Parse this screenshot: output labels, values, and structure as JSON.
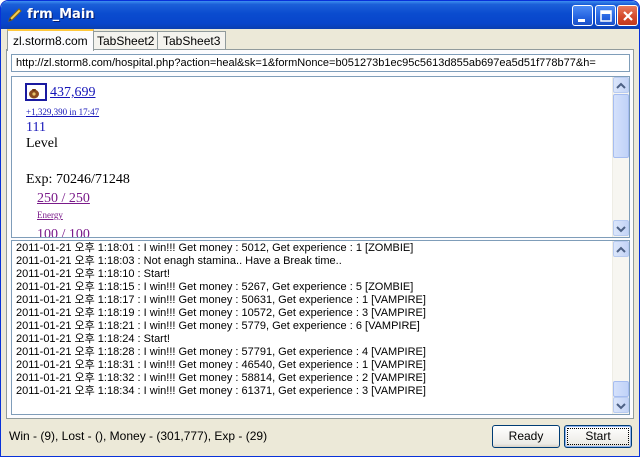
{
  "window": {
    "title": "frm_Main"
  },
  "tabs": [
    {
      "label": "zl.storm8.com"
    },
    {
      "label": "TabSheet2"
    },
    {
      "label": "TabSheet3"
    }
  ],
  "url": {
    "value": "http://zl.storm8.com/hospital.php?action=heal&sk=1&formNonce=b051273b1ec95c5613d855ab697ea5d51f778b77&h="
  },
  "web": {
    "cash": "437,699",
    "cash_sub": "+1,329,390 in 17:47",
    "level_value": "111",
    "level_label": "Level",
    "exp": "Exp: 70246/71248",
    "energy_value": "250 / 250",
    "energy_label": "Energy",
    "health_value": "100 / 100"
  },
  "log": {
    "lines": [
      "2011-01-21 오후 1:18:01 : I win!!! Get money : 5012, Get experience : 1 [ZOMBIE]",
      "2011-01-21 오후 1:18:03 : Not enagh stamina.. Have a Break time..",
      "2011-01-21 오후 1:18:10 : Start!",
      "2011-01-21 오후 1:18:15 : I win!!! Get money : 5267, Get experience : 5 [ZOMBIE]",
      "2011-01-21 오후 1:18:17 : I win!!! Get money : 50631, Get experience : 1 [VAMPIRE]",
      "2011-01-21 오후 1:18:19 : I win!!! Get money : 10572, Get experience : 3 [VAMPIRE]",
      "2011-01-21 오후 1:18:21 : I win!!! Get money : 5779, Get experience : 6 [VAMPIRE]",
      "2011-01-21 오후 1:18:24 : Start!",
      "2011-01-21 오후 1:18:28 : I win!!! Get money : 57791, Get experience : 4 [VAMPIRE]",
      "2011-01-21 오후 1:18:31 : I win!!! Get money : 46540, Get experience : 1 [VAMPIRE]",
      "2011-01-21 오후 1:18:32 : I win!!! Get money : 58814, Get experience : 2 [VAMPIRE]",
      "2011-01-21 오후 1:18:34 : I win!!! Get money : 61371, Get experience : 3 [VAMPIRE]"
    ]
  },
  "status": {
    "text": "Win - (9), Lost - (), Money - (301,777), Exp - (29)"
  },
  "buttons": {
    "ready": "Ready",
    "start": "Start"
  },
  "icons": {
    "app": "app-pen-icon",
    "minimize": "minimize-icon",
    "maximize": "maximize-icon",
    "close": "close-icon",
    "money": "money-bag-icon",
    "scroll_up": "chevron-up-icon",
    "scroll_down": "chevron-down-icon"
  },
  "colors": {
    "titlebar": "#0845cb",
    "link": "#1515b8",
    "close": "#d3472a"
  }
}
